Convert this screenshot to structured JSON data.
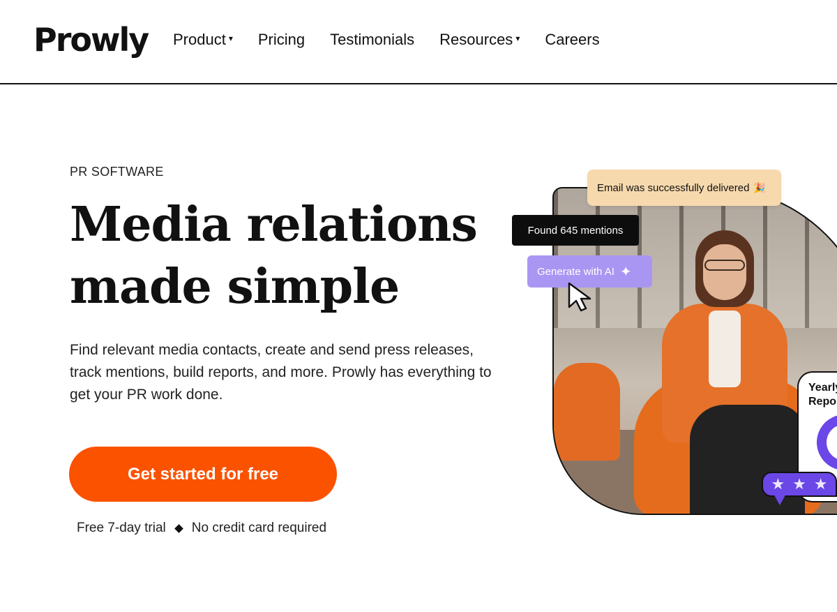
{
  "header": {
    "logo": "Prowly",
    "nav": [
      {
        "label": "Product",
        "has_dropdown": true
      },
      {
        "label": "Pricing",
        "has_dropdown": false
      },
      {
        "label": "Testimonials",
        "has_dropdown": false
      },
      {
        "label": "Resources",
        "has_dropdown": true
      },
      {
        "label": "Careers",
        "has_dropdown": false
      }
    ],
    "caret": "▾"
  },
  "hero": {
    "eyebrow": "PR SOFTWARE",
    "headline_line1": "Media relations",
    "headline_line2": "made simple",
    "subtext": "Find relevant media contacts, create and send press releases, track mentions, build reports, and more. Prowly has everything to get your PR work done.",
    "cta_label": "Get started for free",
    "trial_left": "Free 7-day trial",
    "trial_right": "No credit card required"
  },
  "visual": {
    "email_badge": "Email was successfully delivered",
    "email_emoji": "🎉",
    "found_badge": "Found 645 mentions",
    "ai_badge": "Generate with AI",
    "ai_icon": "✦",
    "report_title": "Yearly\nRepor",
    "stars": [
      "★",
      "★",
      "★"
    ]
  },
  "colors": {
    "accent_orange": "#fb5200",
    "purple": "#6a47e6",
    "lavender": "#a996f3",
    "peach": "#f7d9ae"
  }
}
